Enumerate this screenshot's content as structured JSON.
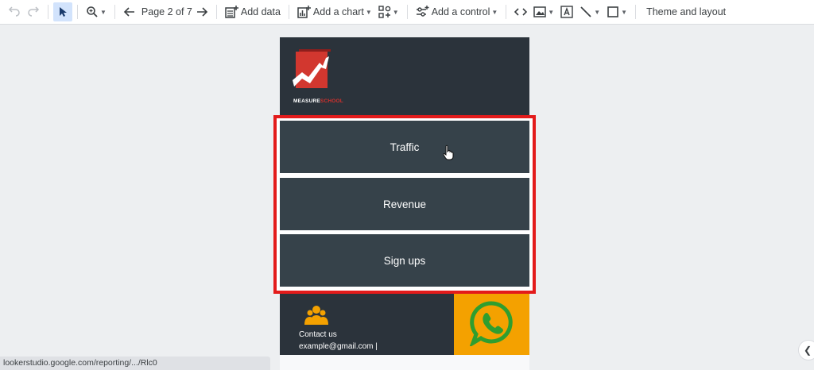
{
  "toolbar": {
    "undo_icon": "undo-icon",
    "redo_icon": "redo-icon",
    "select_icon": "cursor-select-icon",
    "zoom_icon": "zoom-icon",
    "page_indicator": "Page 2 of 7",
    "add_data_label": "Add data",
    "add_chart_label": "Add a chart",
    "add_control_label": "Add a control",
    "theme_label": "Theme and layout"
  },
  "report": {
    "logo": {
      "text_main": "MEASURE",
      "text_accent": "SCHOOL"
    },
    "nav_buttons": [
      {
        "label": "Traffic"
      },
      {
        "label": "Revenue"
      },
      {
        "label": "Sign ups"
      }
    ],
    "contact": {
      "label": "Contact us",
      "email": "example@gmail.com |"
    }
  },
  "status_bar": {
    "url": "lookerstudio.google.com/reporting/.../Rlc0"
  },
  "colors": {
    "header_bg": "#2b333b",
    "button_bg": "#36424a",
    "highlight": "#e31b1b",
    "whatsapp_bg": "#f4a100",
    "whatsapp_green": "#2f9e2f"
  }
}
